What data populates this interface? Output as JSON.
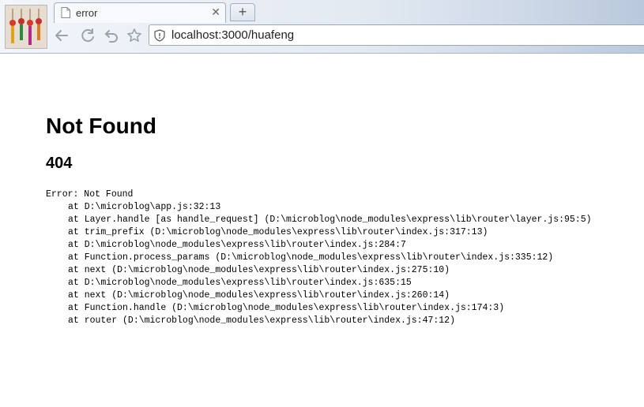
{
  "browser": {
    "tab": {
      "title": "error",
      "close_icon": "close-icon"
    },
    "new_tab_label": "+",
    "address": {
      "url": "localhost:3000/huafeng"
    }
  },
  "page": {
    "title": "Not Found",
    "status": "404",
    "error_line": "Error: Not Found",
    "stack": [
      "at D:\\microblog\\app.js:32:13",
      "at Layer.handle [as handle_request] (D:\\microblog\\node_modules\\express\\lib\\router\\layer.js:95:5)",
      "at trim_prefix (D:\\microblog\\node_modules\\express\\lib\\router\\index.js:317:13)",
      "at D:\\microblog\\node_modules\\express\\lib\\router\\index.js:284:7",
      "at Function.process_params (D:\\microblog\\node_modules\\express\\lib\\router\\index.js:335:12)",
      "at next (D:\\microblog\\node_modules\\express\\lib\\router\\index.js:275:10)",
      "at D:\\microblog\\node_modules\\express\\lib\\router\\index.js:635:15",
      "at next (D:\\microblog\\node_modules\\express\\lib\\router\\index.js:260:14)",
      "at Function.handle (D:\\microblog\\node_modules\\express\\lib\\router\\index.js:174:3)",
      "at router (D:\\microblog\\node_modules\\express\\lib\\router\\index.js:47:12)"
    ]
  }
}
